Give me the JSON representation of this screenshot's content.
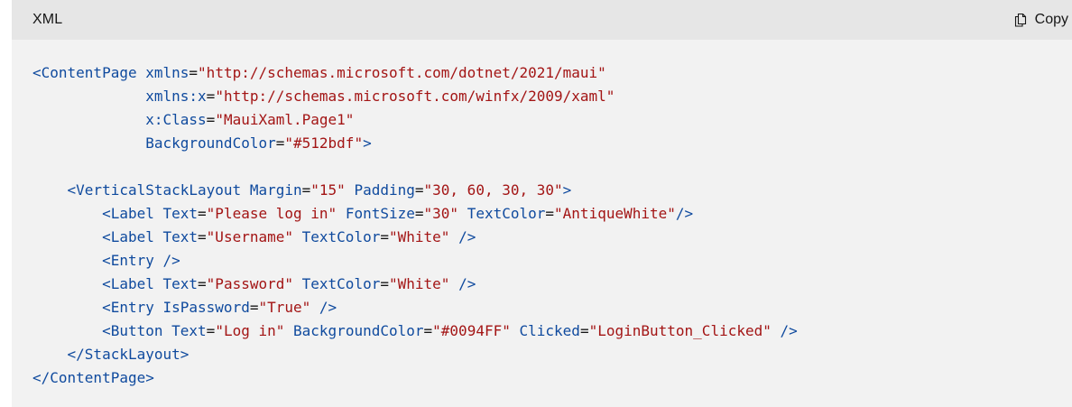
{
  "header": {
    "language": "XML",
    "copy_label": "Copy",
    "copy_icon": "copy-icon"
  },
  "colors": {
    "tag": "#0f4a9e",
    "attr": "#0f4a9e",
    "value": "#a31515",
    "header_bg": "#e6e6e6",
    "body_bg": "#f2f2f2"
  },
  "code_lines": [
    [
      [
        "tag",
        "<ContentPage"
      ],
      [
        "text",
        " "
      ],
      [
        "attr",
        "xmlns"
      ],
      [
        "eq",
        "="
      ],
      [
        "val",
        "\"http://schemas.microsoft.com/dotnet/2021/maui\""
      ]
    ],
    [
      [
        "text",
        "             "
      ],
      [
        "attr",
        "xmlns:x"
      ],
      [
        "eq",
        "="
      ],
      [
        "val",
        "\"http://schemas.microsoft.com/winfx/2009/xaml\""
      ]
    ],
    [
      [
        "text",
        "             "
      ],
      [
        "attr",
        "x:Class"
      ],
      [
        "eq",
        "="
      ],
      [
        "val",
        "\"MauiXaml.Page1\""
      ]
    ],
    [
      [
        "text",
        "             "
      ],
      [
        "attr",
        "BackgroundColor"
      ],
      [
        "eq",
        "="
      ],
      [
        "val",
        "\"#512bdf\""
      ],
      [
        "tag",
        ">"
      ]
    ],
    [
      [
        "text",
        ""
      ]
    ],
    [
      [
        "text",
        "    "
      ],
      [
        "tag",
        "<VerticalStackLayout"
      ],
      [
        "text",
        " "
      ],
      [
        "attr",
        "Margin"
      ],
      [
        "eq",
        "="
      ],
      [
        "val",
        "\"15\""
      ],
      [
        "text",
        " "
      ],
      [
        "attr",
        "Padding"
      ],
      [
        "eq",
        "="
      ],
      [
        "val",
        "\"30, 60, 30, 30\""
      ],
      [
        "tag",
        ">"
      ]
    ],
    [
      [
        "text",
        "        "
      ],
      [
        "tag",
        "<Label"
      ],
      [
        "text",
        " "
      ],
      [
        "attr",
        "Text"
      ],
      [
        "eq",
        "="
      ],
      [
        "val",
        "\"Please log in\""
      ],
      [
        "text",
        " "
      ],
      [
        "attr",
        "FontSize"
      ],
      [
        "eq",
        "="
      ],
      [
        "val",
        "\"30\""
      ],
      [
        "text",
        " "
      ],
      [
        "attr",
        "TextColor"
      ],
      [
        "eq",
        "="
      ],
      [
        "val",
        "\"AntiqueWhite\""
      ],
      [
        "tag",
        "/>"
      ]
    ],
    [
      [
        "text",
        "        "
      ],
      [
        "tag",
        "<Label"
      ],
      [
        "text",
        " "
      ],
      [
        "attr",
        "Text"
      ],
      [
        "eq",
        "="
      ],
      [
        "val",
        "\"Username\""
      ],
      [
        "text",
        " "
      ],
      [
        "attr",
        "TextColor"
      ],
      [
        "eq",
        "="
      ],
      [
        "val",
        "\"White\""
      ],
      [
        "text",
        " "
      ],
      [
        "tag",
        "/>"
      ]
    ],
    [
      [
        "text",
        "        "
      ],
      [
        "tag",
        "<Entry"
      ],
      [
        "text",
        " "
      ],
      [
        "tag",
        "/>"
      ]
    ],
    [
      [
        "text",
        "        "
      ],
      [
        "tag",
        "<Label"
      ],
      [
        "text",
        " "
      ],
      [
        "attr",
        "Text"
      ],
      [
        "eq",
        "="
      ],
      [
        "val",
        "\"Password\""
      ],
      [
        "text",
        " "
      ],
      [
        "attr",
        "TextColor"
      ],
      [
        "eq",
        "="
      ],
      [
        "val",
        "\"White\""
      ],
      [
        "text",
        " "
      ],
      [
        "tag",
        "/>"
      ]
    ],
    [
      [
        "text",
        "        "
      ],
      [
        "tag",
        "<Entry"
      ],
      [
        "text",
        " "
      ],
      [
        "attr",
        "IsPassword"
      ],
      [
        "eq",
        "="
      ],
      [
        "val",
        "\"True\""
      ],
      [
        "text",
        " "
      ],
      [
        "tag",
        "/>"
      ]
    ],
    [
      [
        "text",
        "        "
      ],
      [
        "tag",
        "<Button"
      ],
      [
        "text",
        " "
      ],
      [
        "attr",
        "Text"
      ],
      [
        "eq",
        "="
      ],
      [
        "val",
        "\"Log in\""
      ],
      [
        "text",
        " "
      ],
      [
        "attr",
        "BackgroundColor"
      ],
      [
        "eq",
        "="
      ],
      [
        "val",
        "\"#0094FF\""
      ],
      [
        "text",
        " "
      ],
      [
        "attr",
        "Clicked"
      ],
      [
        "eq",
        "="
      ],
      [
        "val",
        "\"LoginButton_Clicked\""
      ],
      [
        "text",
        " "
      ],
      [
        "tag",
        "/>"
      ]
    ],
    [
      [
        "text",
        "    "
      ],
      [
        "tag",
        "</StackLayout>"
      ]
    ],
    [
      [
        "tag",
        "</ContentPage>"
      ]
    ]
  ]
}
